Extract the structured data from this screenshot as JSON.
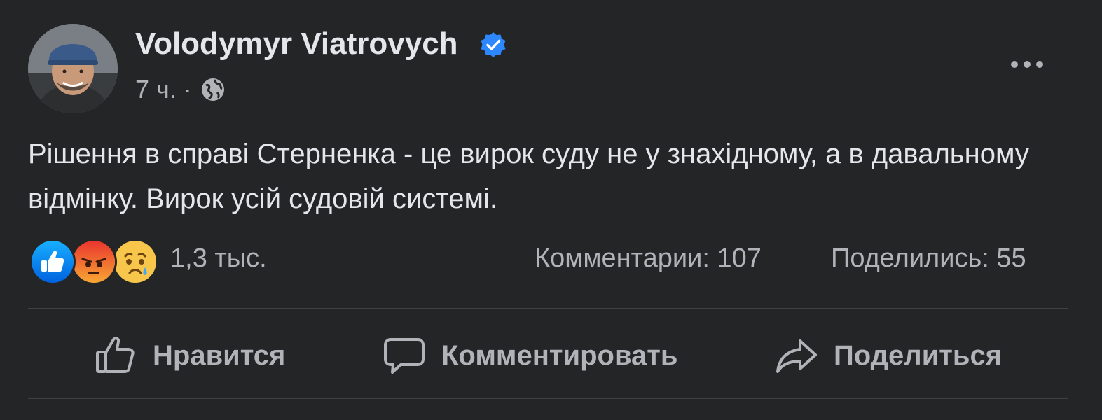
{
  "post": {
    "author": "Volodymyr Viatrovych",
    "time": "7 ч.",
    "separator": "·",
    "text": "Рішення в справі Стерненка - це вирок суду не у знахідному, а в давальному відмінку. Вирок усій судовій системі."
  },
  "reactions": {
    "types": [
      "like-icon",
      "angry-icon",
      "sad-icon"
    ],
    "count": "1,3 тыс."
  },
  "stats": {
    "comments": "Комментарии: 107",
    "shares": "Поделились: 55"
  },
  "actions": {
    "like": "Нравится",
    "comment": "Комментировать",
    "share": "Поделиться"
  },
  "colors": {
    "background": "#242526",
    "primary_text": "#e4e6eb",
    "secondary_text": "#b0b3b8",
    "verified": "#2d88ff",
    "divider": "#3e4042"
  }
}
